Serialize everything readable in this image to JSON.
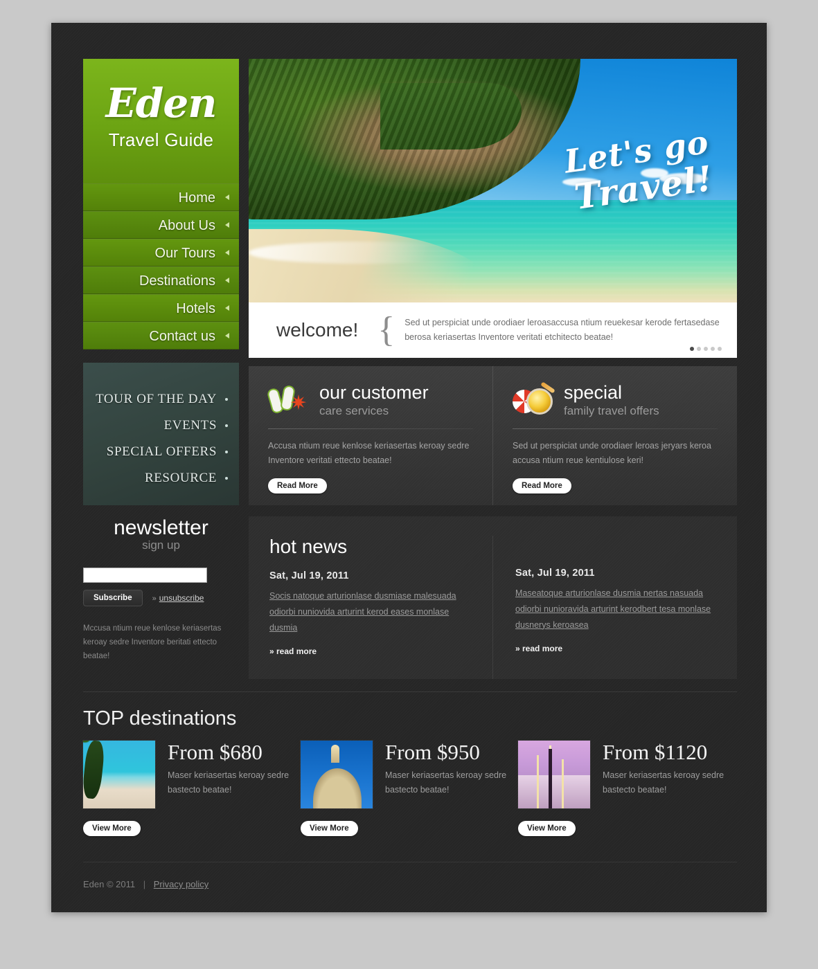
{
  "brand": {
    "name": "Eden",
    "tagline": "Travel Guide"
  },
  "nav": [
    {
      "label": "Home"
    },
    {
      "label": "About Us"
    },
    {
      "label": "Our Tours"
    },
    {
      "label": "Destinations"
    },
    {
      "label": "Hotels"
    },
    {
      "label": "Contact us"
    }
  ],
  "sidebox": [
    {
      "label": "TOUR OF THE DAY"
    },
    {
      "label": "EVENTS"
    },
    {
      "label": "SPECIAL OFFERS"
    },
    {
      "label": "RESOURCE"
    }
  ],
  "hero": {
    "headline_line1": "Let's go",
    "headline_line2": "Travel!",
    "welcome_title": "welcome!",
    "brace": "{",
    "welcome_text": "Sed ut perspiciat unde orodiaer leroasaccusa ntium reuekesar kerode fertasedase berosa keriasertas Inventore veritati etchitecto beatae!",
    "slides": 5,
    "active_slide": 1
  },
  "services": [
    {
      "icon": "flip-flops-starfish-icon",
      "title": "our customer",
      "subtitle": "care services",
      "body": "Accusa ntium reue kenlose keriasertas keroay sedre Inventore veritati ettecto beatae!",
      "button": "Read More"
    },
    {
      "icon": "beach-umbrella-coin-icon",
      "title": "special",
      "subtitle": "family travel offers",
      "body": "Sed ut perspiciat unde orodiaer leroas jeryars keroa accusa ntium reue kentiulose keri!",
      "button": "Read More"
    }
  ],
  "newsletter": {
    "title": "newsletter",
    "subtitle": "sign up",
    "input_value": "",
    "input_placeholder": "",
    "subscribe_label": "Subscribe",
    "unsubscribe_label": "unsubscribe",
    "unsubscribe_arrow": "»",
    "note": "Mccusa ntium reue kenlose keriasertas keroay sedre Inventore beritati ettecto beatae!"
  },
  "hot_news": {
    "heading": "hot news",
    "items": [
      {
        "date": "Sat, Jul 19, 2011",
        "text": "Socis natoque arturionlase dusmiase malesuada odiorbi nuniovida arturint kerod eases monlase dusmia",
        "more": "» read more"
      },
      {
        "date": "Sat, Jul 19, 2011",
        "text": "Maseatoque arturionlase dusmia nertas nasuada odiorbi nunioravida arturint kerodbert tesa monlase dusnerys keroasea",
        "more": "» read more"
      }
    ]
  },
  "destinations": {
    "heading": "TOP destinations",
    "items": [
      {
        "image": "beach-palm-thumbnail",
        "price": "From $680",
        "desc": "Maser keriasertas keroay sedre bastecto beatae!",
        "button": "View More"
      },
      {
        "image": "venice-basilica-thumbnail",
        "price": "From $950",
        "desc": "Maser keriasertas keroay sedre bastecto beatae!",
        "button": "View More"
      },
      {
        "image": "street-lamp-thumbnail",
        "price": "From $1120",
        "desc": "Maser keriasertas keroay sedre bastecto beatae!",
        "button": "View More"
      }
    ]
  },
  "footer": {
    "copyright": "Eden © 2011",
    "separator": "|",
    "privacy": "Privacy policy"
  },
  "colors": {
    "brand_green": "#6ca413",
    "page_bg": "#c9c9c9",
    "panel_dark": "#262626",
    "accent_teal": "#3b4e4b"
  }
}
